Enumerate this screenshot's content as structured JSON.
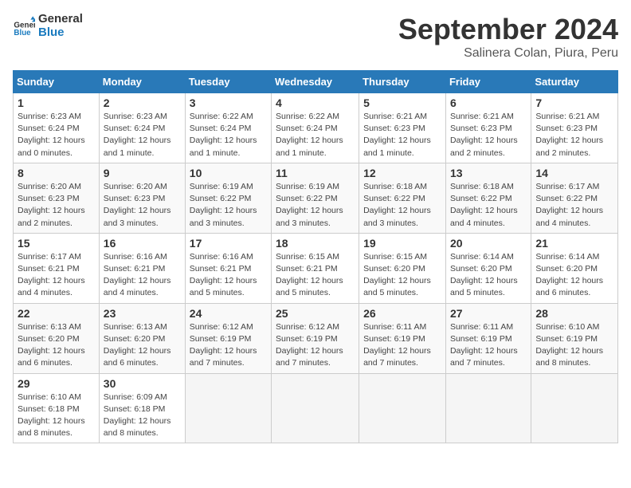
{
  "logo": {
    "text_general": "General",
    "text_blue": "Blue"
  },
  "header": {
    "month": "September 2024",
    "location": "Salinera Colan, Piura, Peru"
  },
  "days_of_week": [
    "Sunday",
    "Monday",
    "Tuesday",
    "Wednesday",
    "Thursday",
    "Friday",
    "Saturday"
  ],
  "weeks": [
    [
      {
        "day": "1",
        "info": "Sunrise: 6:23 AM\nSunset: 6:24 PM\nDaylight: 12 hours\nand 0 minutes."
      },
      {
        "day": "2",
        "info": "Sunrise: 6:23 AM\nSunset: 6:24 PM\nDaylight: 12 hours\nand 1 minute."
      },
      {
        "day": "3",
        "info": "Sunrise: 6:22 AM\nSunset: 6:24 PM\nDaylight: 12 hours\nand 1 minute."
      },
      {
        "day": "4",
        "info": "Sunrise: 6:22 AM\nSunset: 6:24 PM\nDaylight: 12 hours\nand 1 minute."
      },
      {
        "day": "5",
        "info": "Sunrise: 6:21 AM\nSunset: 6:23 PM\nDaylight: 12 hours\nand 1 minute."
      },
      {
        "day": "6",
        "info": "Sunrise: 6:21 AM\nSunset: 6:23 PM\nDaylight: 12 hours\nand 2 minutes."
      },
      {
        "day": "7",
        "info": "Sunrise: 6:21 AM\nSunset: 6:23 PM\nDaylight: 12 hours\nand 2 minutes."
      }
    ],
    [
      {
        "day": "8",
        "info": "Sunrise: 6:20 AM\nSunset: 6:23 PM\nDaylight: 12 hours\nand 2 minutes."
      },
      {
        "day": "9",
        "info": "Sunrise: 6:20 AM\nSunset: 6:23 PM\nDaylight: 12 hours\nand 3 minutes."
      },
      {
        "day": "10",
        "info": "Sunrise: 6:19 AM\nSunset: 6:22 PM\nDaylight: 12 hours\nand 3 minutes."
      },
      {
        "day": "11",
        "info": "Sunrise: 6:19 AM\nSunset: 6:22 PM\nDaylight: 12 hours\nand 3 minutes."
      },
      {
        "day": "12",
        "info": "Sunrise: 6:18 AM\nSunset: 6:22 PM\nDaylight: 12 hours\nand 3 minutes."
      },
      {
        "day": "13",
        "info": "Sunrise: 6:18 AM\nSunset: 6:22 PM\nDaylight: 12 hours\nand 4 minutes."
      },
      {
        "day": "14",
        "info": "Sunrise: 6:17 AM\nSunset: 6:22 PM\nDaylight: 12 hours\nand 4 minutes."
      }
    ],
    [
      {
        "day": "15",
        "info": "Sunrise: 6:17 AM\nSunset: 6:21 PM\nDaylight: 12 hours\nand 4 minutes."
      },
      {
        "day": "16",
        "info": "Sunrise: 6:16 AM\nSunset: 6:21 PM\nDaylight: 12 hours\nand 4 minutes."
      },
      {
        "day": "17",
        "info": "Sunrise: 6:16 AM\nSunset: 6:21 PM\nDaylight: 12 hours\nand 5 minutes."
      },
      {
        "day": "18",
        "info": "Sunrise: 6:15 AM\nSunset: 6:21 PM\nDaylight: 12 hours\nand 5 minutes."
      },
      {
        "day": "19",
        "info": "Sunrise: 6:15 AM\nSunset: 6:20 PM\nDaylight: 12 hours\nand 5 minutes."
      },
      {
        "day": "20",
        "info": "Sunrise: 6:14 AM\nSunset: 6:20 PM\nDaylight: 12 hours\nand 5 minutes."
      },
      {
        "day": "21",
        "info": "Sunrise: 6:14 AM\nSunset: 6:20 PM\nDaylight: 12 hours\nand 6 minutes."
      }
    ],
    [
      {
        "day": "22",
        "info": "Sunrise: 6:13 AM\nSunset: 6:20 PM\nDaylight: 12 hours\nand 6 minutes."
      },
      {
        "day": "23",
        "info": "Sunrise: 6:13 AM\nSunset: 6:20 PM\nDaylight: 12 hours\nand 6 minutes."
      },
      {
        "day": "24",
        "info": "Sunrise: 6:12 AM\nSunset: 6:19 PM\nDaylight: 12 hours\nand 7 minutes."
      },
      {
        "day": "25",
        "info": "Sunrise: 6:12 AM\nSunset: 6:19 PM\nDaylight: 12 hours\nand 7 minutes."
      },
      {
        "day": "26",
        "info": "Sunrise: 6:11 AM\nSunset: 6:19 PM\nDaylight: 12 hours\nand 7 minutes."
      },
      {
        "day": "27",
        "info": "Sunrise: 6:11 AM\nSunset: 6:19 PM\nDaylight: 12 hours\nand 7 minutes."
      },
      {
        "day": "28",
        "info": "Sunrise: 6:10 AM\nSunset: 6:19 PM\nDaylight: 12 hours\nand 8 minutes."
      }
    ],
    [
      {
        "day": "29",
        "info": "Sunrise: 6:10 AM\nSunset: 6:18 PM\nDaylight: 12 hours\nand 8 minutes."
      },
      {
        "day": "30",
        "info": "Sunrise: 6:09 AM\nSunset: 6:18 PM\nDaylight: 12 hours\nand 8 minutes."
      },
      null,
      null,
      null,
      null,
      null
    ]
  ]
}
